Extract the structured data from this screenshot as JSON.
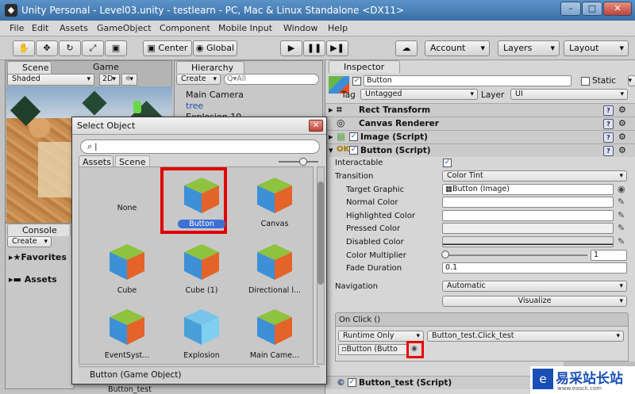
{
  "window": {
    "title": "Unity Personal - Level03.unity - testlearn - PC, Mac & Linux Standalone <DX11>",
    "minimize": "–",
    "maximize": "□",
    "close": "✕"
  },
  "menu": [
    "File",
    "Edit",
    "Assets",
    "GameObject",
    "Component",
    "Mobile Input",
    "Window",
    "Help"
  ],
  "toolbar": {
    "center": "Center",
    "global": "Global",
    "account": "Account",
    "layers": "Layers",
    "layout": "Layout"
  },
  "scene": {
    "tab_scene": "Scene",
    "tab_game": "Game",
    "shaded": "Shaded",
    "twod": "2D"
  },
  "hierarchy": {
    "tab": "Hierarchy",
    "create": "Create",
    "search": "Q▾All",
    "items": [
      "Main Camera",
      "tree",
      "Explosion 10"
    ]
  },
  "console": {
    "tab": "Console",
    "create": "Create",
    "favorites": "Favorites",
    "assets": "Assets",
    "bottom_item": "Button_test"
  },
  "dialog": {
    "title": "Select Object",
    "search_value": "",
    "tab_assets": "Assets",
    "tab_scene": "Scene",
    "items": [
      {
        "label": "None",
        "kind": "none"
      },
      {
        "label": "Button",
        "kind": "cube",
        "selected": true
      },
      {
        "label": "Canvas",
        "kind": "cube"
      },
      {
        "label": "Cube",
        "kind": "cube"
      },
      {
        "label": "Cube (1)",
        "kind": "cube"
      },
      {
        "label": "Directional l...",
        "kind": "cube"
      },
      {
        "label": "EventSyst...",
        "kind": "cube"
      },
      {
        "label": "Explosion",
        "kind": "cube-blue"
      },
      {
        "label": "Main Came...",
        "kind": "cube"
      }
    ],
    "status": "Button (Game Object)"
  },
  "inspector": {
    "tab": "Inspector",
    "name": "Button",
    "static": "Static",
    "tag_label": "Tag",
    "tag_value": "Untagged",
    "layer_label": "Layer",
    "layer_value": "UI",
    "components": {
      "rect": "Rect Transform",
      "canvas_renderer": "Canvas Renderer",
      "image": "Image (Script)",
      "button": "Button (Script)",
      "button_test": "Button_test (Script)"
    },
    "props": {
      "interactable": "Interactable",
      "transition": "Transition",
      "transition_value": "Color Tint",
      "target_graphic": "Target Graphic",
      "target_graphic_value": "Button (Image)",
      "normal": "Normal Color",
      "highlighted": "Highlighted Color",
      "pressed": "Pressed Color",
      "disabled": "Disabled Color",
      "multiplier": "Color Multiplier",
      "multiplier_value": "1",
      "fade": "Fade Duration",
      "fade_value": "0.1",
      "navigation": "Navigation",
      "navigation_value": "Automatic",
      "visualize": "Visualize",
      "onclick": "On Click ()",
      "runtime": "Runtime Only",
      "function": "Button_test.Click_test",
      "object_field": "Button (Butto"
    }
  },
  "watermark": {
    "text": "易采站长站",
    "url": "www.easck.com"
  },
  "colors": {
    "titlebar": "#3b6fa4",
    "highlight_red": "#e00000",
    "selection_blue": "#3d6fd6"
  }
}
